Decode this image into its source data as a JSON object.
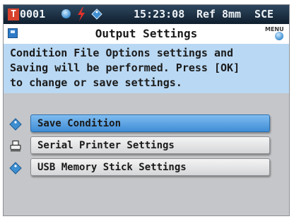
{
  "status_bar": {
    "badge": "T",
    "condition_number": "0001",
    "time": "15:23:08",
    "reference_label": "Ref",
    "aperture": "8mm",
    "mode": "SCE",
    "icons": [
      "blue-circle-icon",
      "lightning-icon",
      "tag-icon"
    ]
  },
  "header": {
    "title": "Output Settings",
    "menu_label": "MENU"
  },
  "message": {
    "line1": "Condition File Options settings and",
    "line2": "Saving will be performed. Press [OK]",
    "line3": "to change or save settings."
  },
  "menu": {
    "selected_index": 0,
    "items": [
      {
        "label": "Save Condition",
        "icon": "tag-icon"
      },
      {
        "label": "Serial Printer Settings",
        "icon": "printer-icon"
      },
      {
        "label": "USB Memory Stick Settings",
        "icon": "tag-icon"
      }
    ]
  },
  "colors": {
    "status_bar": "#1f3348",
    "message_panel": "#b9d8f3",
    "screen_background": "#c4c6c9",
    "selected_item": "#4f9be0",
    "badge": "#d8412c",
    "bolt": "#e3322b",
    "icon_blue": "#3d8fd1"
  }
}
